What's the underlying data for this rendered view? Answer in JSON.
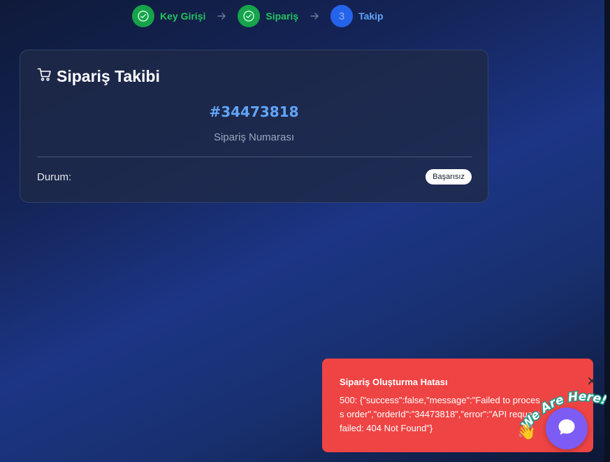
{
  "stepper": {
    "steps": [
      {
        "label": "Key Girişi",
        "state": "done",
        "icon": "check-circle-icon"
      },
      {
        "label": "Sipariş",
        "state": "done",
        "icon": "check-circle-icon"
      },
      {
        "label": "Takip",
        "state": "active",
        "number": "3"
      }
    ],
    "separator_icon": "arrow-right-icon"
  },
  "card": {
    "icon": "shopping-cart-icon",
    "title": "Sipariş Takibi",
    "order_number": "#34473818",
    "order_caption": "Sipariş Numarası",
    "status_label": "Durum:",
    "status_value": "Başarısız"
  },
  "toast": {
    "title": "Sipariş Oluşturma Hatası",
    "message": "500: {\"success\":false,\"message\":\"Failed to process order\",\"orderId\":\"34473818\",\"error\":\"API request failed: 404 Not Found\"}",
    "close_icon": "close-icon"
  },
  "chat_widget": {
    "banner_text": "We Are Here!",
    "icon": "chat-icon",
    "emoji": "👋"
  },
  "colors": {
    "success": "#16a34a",
    "active": "#2563eb",
    "accent_blue": "#60a5fa",
    "error": "#ef4444",
    "chat": "#7c5cf5"
  }
}
